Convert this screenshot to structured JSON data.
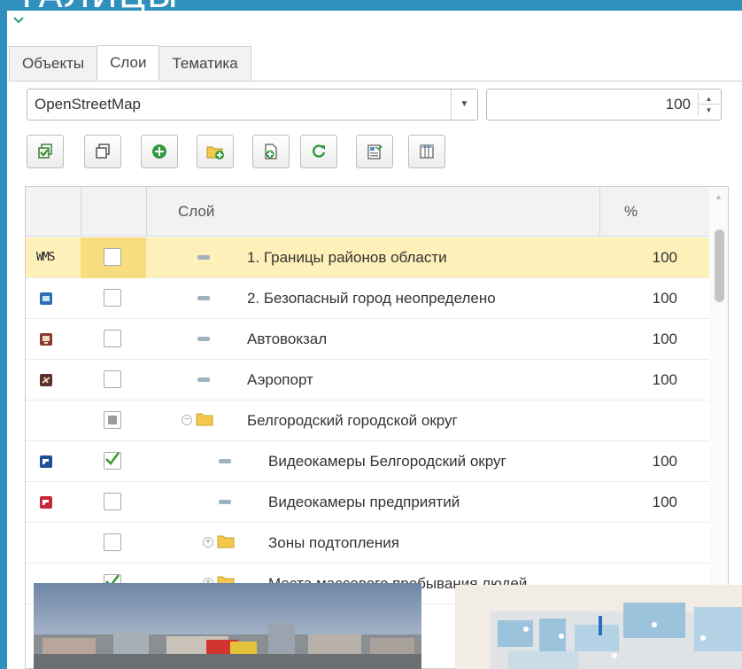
{
  "slide_title": "ТАЛИЦЫ",
  "tabs": [
    {
      "label": "Объекты",
      "active": false
    },
    {
      "label": "Слои",
      "active": true
    },
    {
      "label": "Тематика",
      "active": false
    }
  ],
  "base_map": {
    "selected": "OpenStreetMap"
  },
  "opacity": {
    "value": "100"
  },
  "toolbar_icons": [
    "select-all-icon",
    "deselect-all-icon",
    "add-layer-icon",
    "add-folder-icon",
    "add-file-icon",
    "refresh-icon",
    "export-icon",
    "columns-icon"
  ],
  "grid": {
    "header": {
      "layer": "Слой",
      "percent": "%"
    },
    "rows": [
      {
        "type": "WMS",
        "icon": "wms-icon",
        "checked": false,
        "name": "1. Границы районов области",
        "percent": "100",
        "selected": true
      },
      {
        "type": "layer",
        "icon": "blue-camera-icon",
        "checked": false,
        "name": "2. Безопасный город неопределено",
        "percent": "100"
      },
      {
        "type": "layer",
        "icon": "bus-station-icon",
        "checked": false,
        "name": "Автовокзал",
        "percent": "100"
      },
      {
        "type": "layer",
        "icon": "airport-icon",
        "checked": false,
        "name": "Аэропорт",
        "percent": "100"
      },
      {
        "type": "folder",
        "expanded": true,
        "checked": "mixed",
        "name": "Белгородский городской округ",
        "percent": ""
      },
      {
        "type": "layer",
        "icon": "camera-district-icon",
        "checked": true,
        "name": "Видеокамеры Белгородский округ",
        "percent": "100"
      },
      {
        "type": "layer",
        "icon": "camera-company-icon",
        "checked": false,
        "name": "Видеокамеры предприятий",
        "percent": "100"
      },
      {
        "type": "folder",
        "expanded": false,
        "checked": false,
        "name": "Зоны подтопления",
        "percent": ""
      },
      {
        "type": "folder",
        "expanded": false,
        "checked": true,
        "name": "Места массового пребывания людей",
        "percent": ""
      }
    ]
  },
  "wms_label": "WMS",
  "colors": {
    "background": "#2f8fbd",
    "selected_row": "#fdf0b8",
    "check_green": "#3a9b3a"
  }
}
